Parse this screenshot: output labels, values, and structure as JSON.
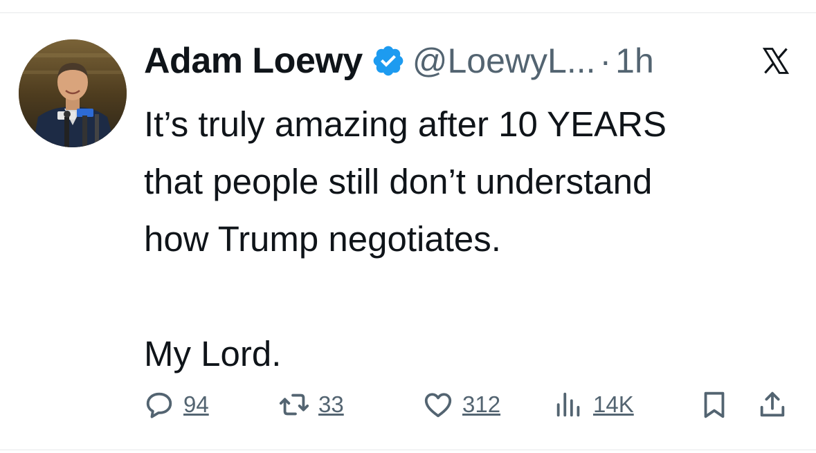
{
  "tweet": {
    "display_name": "Adam Loewy",
    "handle": "@LoewyL...",
    "separator": "·",
    "time": "1h",
    "text_lines": [
      "It’s truly amazing after 10 YEARS",
      "that people still don’t understand",
      "how Trump negotiates.",
      "My Lord."
    ]
  },
  "actions": {
    "replies": "94",
    "reposts": "33",
    "likes": "312",
    "views": "14K"
  },
  "icons": {
    "reply": "speech-bubble-icon",
    "repost": "repost-arrows-icon",
    "like": "heart-icon",
    "views": "bar-chart-icon",
    "bookmark": "bookmark-icon",
    "share": "share-upload-icon",
    "verified": "verified-badge-icon",
    "platform": "x-logo-icon"
  },
  "colors": {
    "text": "#0f1419",
    "secondary": "#536471",
    "verified": "#1d9bf0"
  }
}
